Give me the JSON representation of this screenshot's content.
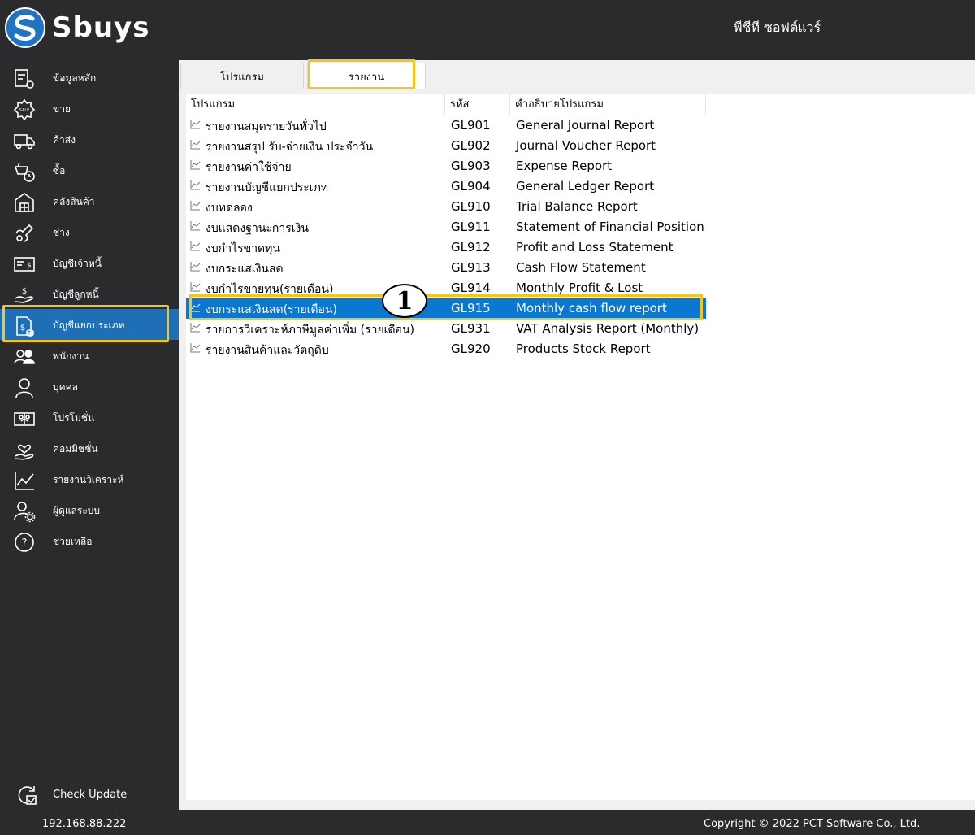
{
  "app": {
    "brand": "Sbuys",
    "company": "พีซีที ซอฟต์แวร์"
  },
  "sidebar": {
    "items": [
      {
        "label": "ข้อมูลหลัก",
        "icon": "master-data-icon"
      },
      {
        "label": "ขาย",
        "icon": "sale-badge-icon"
      },
      {
        "label": "ค้าส่ง",
        "icon": "truck-icon"
      },
      {
        "label": "ซื้อ",
        "icon": "basket-icon"
      },
      {
        "label": "คลังสินค้า",
        "icon": "warehouse-icon"
      },
      {
        "label": "ช่าง",
        "icon": "wrench-icon"
      },
      {
        "label": "บัญชีเจ้าหนี้",
        "icon": "payable-icon"
      },
      {
        "label": "บัญชีลูกหนี้",
        "icon": "receivable-icon"
      },
      {
        "label": "บัญชีแยกประเภท",
        "icon": "ledger-icon"
      },
      {
        "label": "พนักงาน",
        "icon": "employees-icon"
      },
      {
        "label": "บุคคล",
        "icon": "person-icon"
      },
      {
        "label": "โปรโมชั่น",
        "icon": "promotion-icon"
      },
      {
        "label": "คอมมิชชั่น",
        "icon": "commission-icon"
      },
      {
        "label": "รายงานวิเคราะห์",
        "icon": "chart-icon"
      },
      {
        "label": "ผู้ดูแลระบบ",
        "icon": "admin-icon"
      },
      {
        "label": "ช่วยเหลือ",
        "icon": "help-icon"
      }
    ],
    "active_index": 8,
    "check_update": "Check Update"
  },
  "tabs": [
    {
      "label": "โปรแกรม"
    },
    {
      "label": "รายงาน"
    }
  ],
  "table": {
    "columns": [
      "โปรแกรม",
      "รหัส",
      "คำอธิบายโปรแกรม"
    ],
    "rows": [
      {
        "name": "รายงานสมุดรายวันทั่วไป",
        "code": "GL901",
        "desc": "General Journal Report"
      },
      {
        "name": "รายงานสรุป รับ-จ่ายเงิน ประจำวัน",
        "code": "GL902",
        "desc": "Journal Voucher Report"
      },
      {
        "name": "รายงานค่าใช้จ่าย",
        "code": "GL903",
        "desc": "Expense Report"
      },
      {
        "name": "รายงานบัญชีแยกประเภท",
        "code": "GL904",
        "desc": "General Ledger Report"
      },
      {
        "name": "งบทดลอง",
        "code": "GL910",
        "desc": "Trial Balance Report"
      },
      {
        "name": "งบแสดงฐานะการเงิน",
        "code": "GL911",
        "desc": "Statement of Financial Position"
      },
      {
        "name": "งบกำไรขาดทุน",
        "code": "GL912",
        "desc": "Profit and Loss Statement"
      },
      {
        "name": "งบกระแสเงินสด",
        "code": "GL913",
        "desc": "Cash Flow Statement"
      },
      {
        "name": "งบกำไรขายทุน(รายเดือน)",
        "code": "GL914",
        "desc": "Monthly Profit & Lost"
      },
      {
        "name": "งบกระแสเงินสด(รายเดือน)",
        "code": "GL915",
        "desc": "Monthly cash flow report"
      },
      {
        "name": "รายการวิเคราะห์ภาษีมูลค่าเพิ่ม (รายเดือน)",
        "code": "GL931",
        "desc": "VAT Analysis Report (Monthly)"
      },
      {
        "name": "รายงานสินค้าและวัตถุดิบ",
        "code": "GL920",
        "desc": "Products Stock Report"
      }
    ],
    "selected_index": 9
  },
  "annotation": {
    "callout": "1"
  },
  "footer": {
    "ip": "192.168.88.222",
    "copyright": "Copyright © 2022 PCT Software Co., Ltd."
  },
  "colors": {
    "sidebar_bg": "#2b2b2d",
    "active_bg": "#1e6fb5",
    "selection_bg": "#0a77d1",
    "highlight": "#f5c518"
  }
}
